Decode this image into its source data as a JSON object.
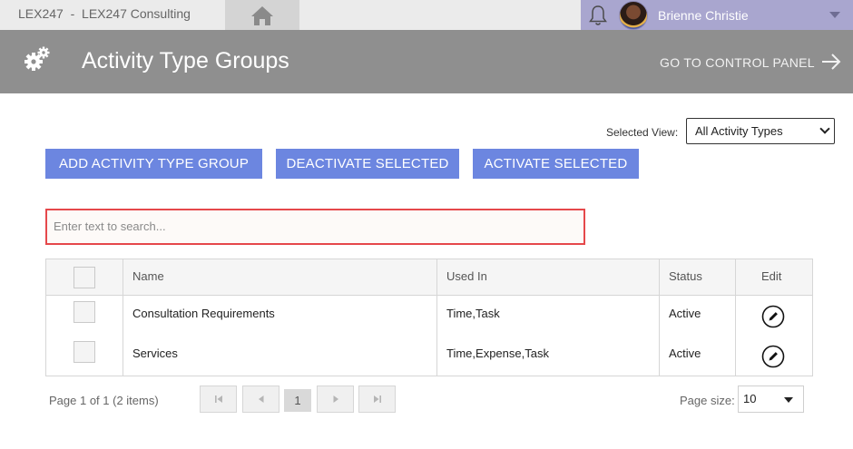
{
  "topbar": {
    "brand": "LEX247  -  LEX247 Consulting",
    "user_name": "Brienne Christie"
  },
  "header": {
    "title": "Activity Type Groups",
    "control_panel_link": "GO TO CONTROL PANEL"
  },
  "view": {
    "label": "Selected View:",
    "selected": "All Activity Types"
  },
  "actions": {
    "add": "ADD ACTIVITY TYPE GROUP",
    "deactivate": "DEACTIVATE SELECTED",
    "activate": "ACTIVATE SELECTED"
  },
  "search": {
    "placeholder": "Enter text to search..."
  },
  "grid": {
    "columns": [
      "Name",
      "Used In",
      "Status",
      "Edit"
    ],
    "rows": [
      {
        "name": "Consultation Requirements",
        "used_in": "Time,Task",
        "status": "Active"
      },
      {
        "name": "Services",
        "used_in": "Time,Expense,Task",
        "status": "Active"
      }
    ]
  },
  "pager": {
    "info": "Page 1 of 1 (2 items)",
    "current_page": "1",
    "size_label": "Page size:",
    "size_value": "10"
  },
  "colors": {
    "accent_button": "#6c86e0",
    "header_band": "#8f8f8f",
    "user_area": "#a9a6cf",
    "search_border": "#e5484b"
  },
  "icons": [
    "home-icon",
    "bell-icon",
    "gears-icon",
    "arrow-right-icon",
    "pencil-icon",
    "first-page-icon",
    "prev-page-icon",
    "next-page-icon",
    "last-page-icon"
  ]
}
